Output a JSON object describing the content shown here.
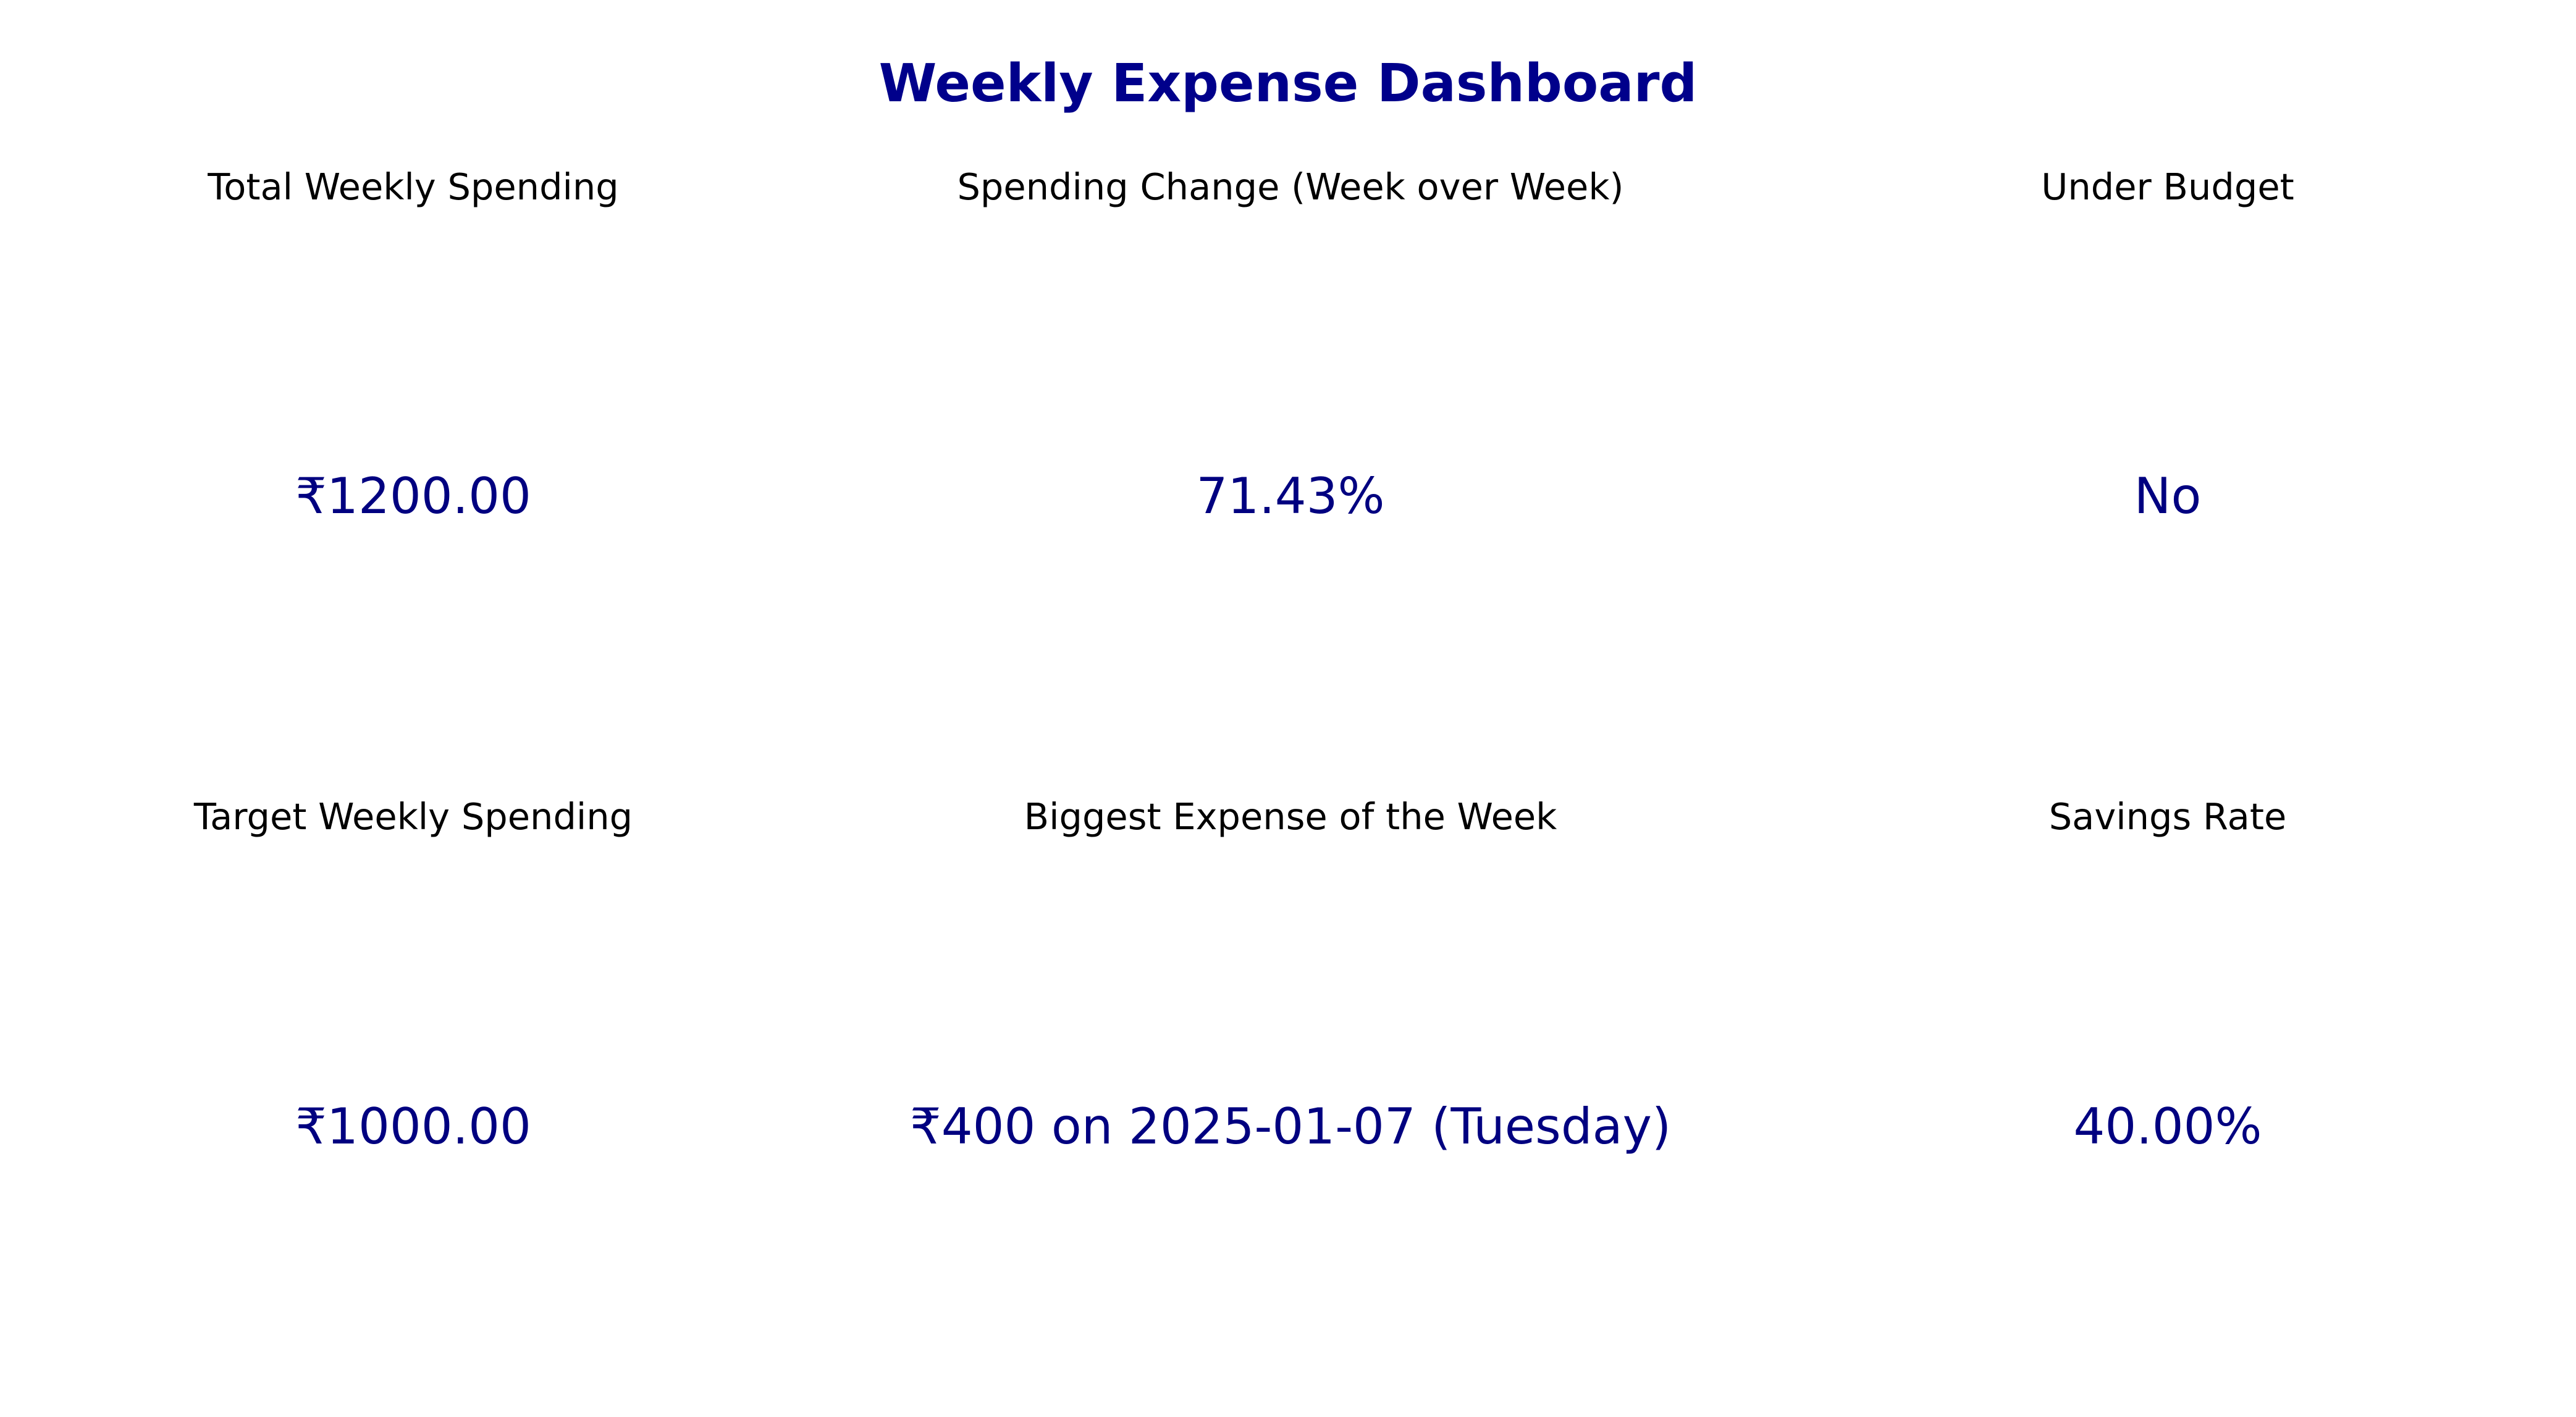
{
  "title": "Weekly Expense Dashboard",
  "colors": {
    "title": "#00008b",
    "value": "#000080",
    "label": "#000000",
    "background": "#ffffff"
  },
  "cards": [
    {
      "label": "Total Weekly Spending",
      "value": "₹1200.00"
    },
    {
      "label": "Spending Change (Week over Week)",
      "value": "71.43%"
    },
    {
      "label": "Under Budget",
      "value": "No"
    },
    {
      "label": "Target Weekly Spending",
      "value": "₹1000.00"
    },
    {
      "label": "Biggest Expense of the Week",
      "value": "₹400 on 2025-01-07 (Tuesday)"
    },
    {
      "label": "Savings Rate",
      "value": "40.00%"
    }
  ]
}
